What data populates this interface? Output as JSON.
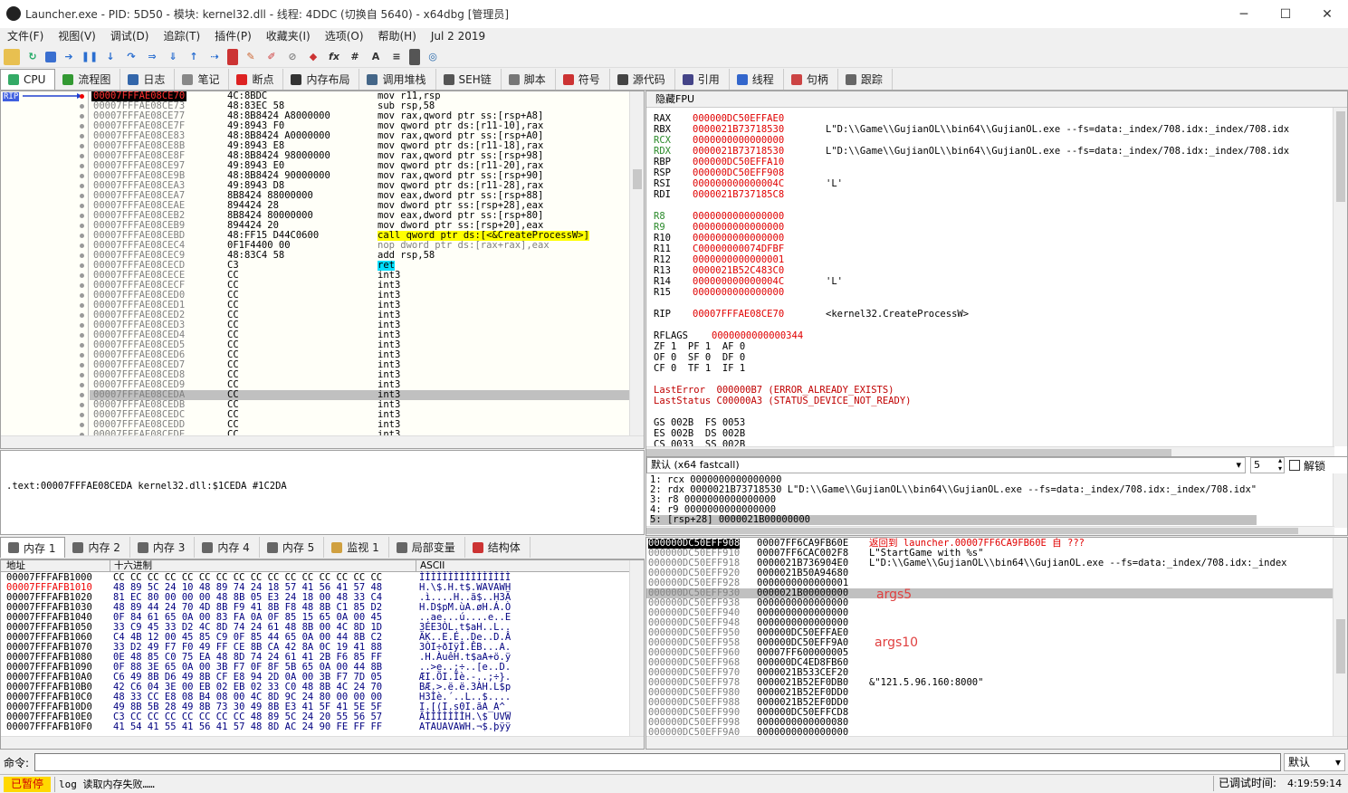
{
  "window": {
    "title": "Launcher.exe - PID: 5D50 - 模块: kernel32.dll - 线程: 4DDC (切换自 5640) - x64dbg [管理员]"
  },
  "menu": [
    "文件(F)",
    "视图(V)",
    "调试(D)",
    "追踪(T)",
    "插件(P)",
    "收藏夹(I)",
    "选项(O)",
    "帮助(H)",
    "Jul 2 2019"
  ],
  "tabs": [
    {
      "label": "CPU",
      "icon": "cpu-icon",
      "color": "#3a6"
    },
    {
      "label": "流程图",
      "icon": "graph-icon",
      "color": "#393"
    },
    {
      "label": "日志",
      "icon": "log-icon",
      "color": "#36a"
    },
    {
      "label": "笔记",
      "icon": "notes-icon",
      "color": "#888"
    },
    {
      "label": "断点",
      "icon": "breakpoint-icon",
      "color": "#d22"
    },
    {
      "label": "内存布局",
      "icon": "memory-map-icon",
      "color": "#333"
    },
    {
      "label": "调用堆栈",
      "icon": "callstack-icon",
      "color": "#468"
    },
    {
      "label": "SEH链",
      "icon": "seh-icon",
      "color": "#555"
    },
    {
      "label": "脚本",
      "icon": "script-icon",
      "color": "#777"
    },
    {
      "label": "符号",
      "icon": "symbols-icon",
      "color": "#c33"
    },
    {
      "label": "源代码",
      "icon": "source-icon",
      "color": "#444"
    },
    {
      "label": "引用",
      "icon": "references-icon",
      "color": "#448"
    },
    {
      "label": "线程",
      "icon": "threads-icon",
      "color": "#36c"
    },
    {
      "label": "句柄",
      "icon": "handles-icon",
      "color": "#c44"
    },
    {
      "label": "跟踪",
      "icon": "trace-icon",
      "color": "#666"
    }
  ],
  "disasm": {
    "rip_label": "RIP",
    "rows": [
      {
        "addr": "00007FFFAE08CE70",
        "bytes": "4C:8BDC",
        "instr": "mov r11,rsp",
        "current": true
      },
      {
        "addr": "00007FFFAE08CE73",
        "bytes": "48:83EC 58",
        "instr": "sub rsp,58"
      },
      {
        "addr": "00007FFFAE08CE77",
        "bytes": "48:8B8424 A8000000",
        "instr": "mov rax,qword ptr ss:[rsp+A8]"
      },
      {
        "addr": "00007FFFAE08CE7F",
        "bytes": "49:8943 F0",
        "instr": "mov qword ptr ds:[r11-10],rax"
      },
      {
        "addr": "00007FFFAE08CE83",
        "bytes": "48:8B8424 A0000000",
        "instr": "mov rax,qword ptr ss:[rsp+A0]"
      },
      {
        "addr": "00007FFFAE08CE8B",
        "bytes": "49:8943 E8",
        "instr": "mov qword ptr ds:[r11-18],rax"
      },
      {
        "addr": "00007FFFAE08CE8F",
        "bytes": "48:8B8424 98000000",
        "instr": "mov rax,qword ptr ss:[rsp+98]"
      },
      {
        "addr": "00007FFFAE08CE97",
        "bytes": "49:8943 E0",
        "instr": "mov qword ptr ds:[r11-20],rax"
      },
      {
        "addr": "00007FFFAE08CE9B",
        "bytes": "48:8B8424 90000000",
        "instr": "mov rax,qword ptr ss:[rsp+90]"
      },
      {
        "addr": "00007FFFAE08CEA3",
        "bytes": "49:8943 D8",
        "instr": "mov qword ptr ds:[r11-28],rax"
      },
      {
        "addr": "00007FFFAE08CEA7",
        "bytes": "8B8424 88000000",
        "instr": "mov eax,dword ptr ss:[rsp+88]"
      },
      {
        "addr": "00007FFFAE08CEAE",
        "bytes": "894424 28",
        "instr": "mov dword ptr ss:[rsp+28],eax"
      },
      {
        "addr": "00007FFFAE08CEB2",
        "bytes": "8B8424 80000000",
        "instr": "mov eax,dword ptr ss:[rsp+80]"
      },
      {
        "addr": "00007FFFAE08CEB9",
        "bytes": "894424 20",
        "instr": "mov dword ptr ss:[rsp+20],eax"
      },
      {
        "addr": "00007FFFAE08CEBD",
        "bytes": "48:FF15 D44C0600",
        "instr": "call qword ptr ds:[<&CreateProcessW>]",
        "call": true
      },
      {
        "addr": "00007FFFAE08CEC4",
        "bytes": "0F1F4400 00",
        "instr": "nop dword ptr ds:[rax+rax],eax",
        "nop": true
      },
      {
        "addr": "00007FFFAE08CEC9",
        "bytes": "48:83C4 58",
        "instr": "add rsp,58"
      },
      {
        "addr": "00007FFFAE08CECD",
        "bytes": "C3",
        "instr": "ret",
        "ret": true
      },
      {
        "addr": "00007FFFAE08CECE",
        "bytes": "CC",
        "instr": "int3"
      },
      {
        "addr": "00007FFFAE08CECF",
        "bytes": "CC",
        "instr": "int3"
      },
      {
        "addr": "00007FFFAE08CED0",
        "bytes": "CC",
        "instr": "int3"
      },
      {
        "addr": "00007FFFAE08CED1",
        "bytes": "CC",
        "instr": "int3"
      },
      {
        "addr": "00007FFFAE08CED2",
        "bytes": "CC",
        "instr": "int3"
      },
      {
        "addr": "00007FFFAE08CED3",
        "bytes": "CC",
        "instr": "int3"
      },
      {
        "addr": "00007FFFAE08CED4",
        "bytes": "CC",
        "instr": "int3"
      },
      {
        "addr": "00007FFFAE08CED5",
        "bytes": "CC",
        "instr": "int3"
      },
      {
        "addr": "00007FFFAE08CED6",
        "bytes": "CC",
        "instr": "int3"
      },
      {
        "addr": "00007FFFAE08CED7",
        "bytes": "CC",
        "instr": "int3"
      },
      {
        "addr": "00007FFFAE08CED8",
        "bytes": "CC",
        "instr": "int3"
      },
      {
        "addr": "00007FFFAE08CED9",
        "bytes": "CC",
        "instr": "int3"
      },
      {
        "addr": "00007FFFAE08CEDA",
        "bytes": "CC",
        "instr": "int3",
        "selected": true
      },
      {
        "addr": "00007FFFAE08CEDB",
        "bytes": "CC",
        "instr": "int3"
      },
      {
        "addr": "00007FFFAE08CEDC",
        "bytes": "CC",
        "instr": "int3"
      },
      {
        "addr": "00007FFFAE08CEDD",
        "bytes": "CC",
        "instr": "int3"
      },
      {
        "addr": "00007FFFAE08CEDE",
        "bytes": "CC",
        "instr": "int3"
      }
    ]
  },
  "info_line": ".text:00007FFFAE08CEDA kernel32.dll:$1CEDA #1C2DA",
  "registers": {
    "header": "隐藏FPU",
    "gp": [
      {
        "name": "RAX",
        "value": "000000DC50EFFAE0",
        "comment": ""
      },
      {
        "name": "RBX",
        "value": "0000021B73718530",
        "comment": "L\"D:\\\\Game\\\\GujianOL\\\\bin64\\\\GujianOL.exe --fs=data:_index/708.idx:_index/708.idx"
      },
      {
        "name": "RCX",
        "value": "0000000000000000",
        "comment": "",
        "hl": true
      },
      {
        "name": "RDX",
        "value": "0000021B73718530",
        "comment": "L\"D:\\\\Game\\\\GujianOL\\\\bin64\\\\GujianOL.exe --fs=data:_index/708.idx:_index/708.idx",
        "hl": true
      },
      {
        "name": "RBP",
        "value": "000000DC50EFFA10",
        "comment": ""
      },
      {
        "name": "RSP",
        "value": "000000DC50EFF908",
        "comment": ""
      },
      {
        "name": "RSI",
        "value": "000000000000004C",
        "comment": "'L'"
      },
      {
        "name": "RDI",
        "value": "0000021B737185C8",
        "comment": ""
      }
    ],
    "ext": [
      {
        "name": "R8",
        "value": "0000000000000000",
        "comment": "",
        "hl": true
      },
      {
        "name": "R9",
        "value": "0000000000000000",
        "comment": "",
        "hl": true
      },
      {
        "name": "R10",
        "value": "0000000000000000",
        "comment": ""
      },
      {
        "name": "R11",
        "value": "C00000000074DFBF",
        "comment": ""
      },
      {
        "name": "R12",
        "value": "0000000000000001",
        "comment": ""
      },
      {
        "name": "R13",
        "value": "0000021B52C483C0",
        "comment": ""
      },
      {
        "name": "R14",
        "value": "000000000000004C",
        "comment": "'L'"
      },
      {
        "name": "R15",
        "value": "0000000000000000",
        "comment": ""
      }
    ],
    "rip": {
      "name": "RIP",
      "value": "00007FFFAE08CE70",
      "comment": "<kernel32.CreateProcessW>"
    },
    "rflags": {
      "name": "RFLAGS",
      "value": "0000000000000344"
    },
    "flags": [
      "ZF 1  PF 1  AF 0",
      "OF 0  SF 0  DF 0",
      "CF 0  TF 1  IF 1"
    ],
    "lasterror": "LastError  000000B7 (ERROR_ALREADY_EXISTS)",
    "laststatus": "LastStatus C00000A3 (STATUS_DEVICE_NOT_READY)",
    "segs": [
      "GS 002B  FS 0053",
      "ES 002B  DS 002B",
      "CS 0033  SS 002B"
    ]
  },
  "callconv": {
    "select": "默认 (x64 fastcall)",
    "count": "5",
    "unlock_label": "解锁",
    "args": [
      "1: rcx 0000000000000000",
      "2: rdx 0000021B73718530 L\"D:\\\\Game\\\\GujianOL\\\\bin64\\\\GujianOL.exe --fs=data:_index/708.idx:_index/708.idx\"",
      "3: r8 0000000000000000",
      "4: r9 0000000000000000",
      "5: [rsp+28] 0000021B00000000"
    ]
  },
  "memtabs": [
    {
      "label": "内存 1",
      "active": true
    },
    {
      "label": "内存 2"
    },
    {
      "label": "内存 3"
    },
    {
      "label": "内存 4"
    },
    {
      "label": "内存 5"
    },
    {
      "label": "监视 1"
    },
    {
      "label": "局部变量"
    },
    {
      "label": "结构体"
    }
  ],
  "dump": {
    "headers": [
      "地址",
      "十六进制",
      "ASCII"
    ],
    "rows": [
      [
        "00007FFFAFB1000",
        "CC CC CC CC CC CC CC CC CC CC CC CC CC CC CC CC",
        "ÌÌÌÌÌÌÌÌÌÌÌÌÌÌÌÌ"
      ],
      [
        "00007FFFAFB1010",
        "48 89 5C 24 10 48 89 74 24 18 57 41 56 41 57 48",
        "H.\\$.H.t$.WAVAWH"
      ],
      [
        "00007FFFAFB1020",
        "81 EC 80 00 00 00 48 8B 05 E3 24 18 00 48 33 C4",
        ".ì....H..ã$..H3Ä"
      ],
      [
        "00007FFFAFB1030",
        "48 89 44 24 70 4D 8B F9 41 8B F8 48 8B C1 85 D2",
        "H.D$pM.ùA.øH.Á.Ò"
      ],
      [
        "00007FFFAFB1040",
        "0F 84 61 65 0A 00 83 FA 0A 0F 85 15 65 0A 00 45",
        "..ae...ú....e..E"
      ],
      [
        "00007FFFAFB1050",
        "33 C9 45 33 D2 4C 8D 74 24 61 48 8B 00 4C 8D 1D",
        "3ÉE3ÒL.t$aH..L.."
      ],
      [
        "00007FFFAFB1060",
        "C4 4B 12 00 45 85 C9 0F 85 44 65 0A 00 44 8B C2",
        "ÄK..E.É..De..D.Â"
      ],
      [
        "00007FFFAFB1070",
        "33 D2 49 F7 F0 49 FF CE 8B CA 42 8A 0C 19 41 88",
        "3ÒI÷ðIÿÎ.ÊB...A."
      ],
      [
        "00007FFFAFB1080",
        "0E 48 85 C0 75 EA 48 8D 74 24 61 41 2B F6 85 FF",
        ".H.ÀuêH.t$aA+ö.ÿ"
      ],
      [
        "00007FFFAFB1090",
        "0F 88 3E 65 0A 00 3B F7 0F 8F 5B 65 0A 00 44 8B",
        "..>e..;÷..[e..D."
      ],
      [
        "00007FFFAFB10A0",
        "C6 49 8B D6 49 8B CF E8 94 2D 0A 00 3B F7 7D 05",
        "ÆI.ÖI.Ïè.-..;÷}."
      ],
      [
        "00007FFFAFB10B0",
        "42 C6 04 3E 00 EB 02 EB 02 33 C0 48 8B 4C 24 70",
        "BÆ.>.ë.ë.3ÀH.L$p"
      ],
      [
        "00007FFFAFB10C0",
        "48 33 CC E8 08 B4 08 00 4C 8D 9C 24 80 00 00 00",
        "H3Ìè.´..L..$...."
      ],
      [
        "00007FFFAFB10D0",
        "49 8B 5B 28 49 8B 73 30 49 8B E3 41 5F 41 5E 5F",
        "I.[(I.s0I.ãA_A^_"
      ],
      [
        "00007FFFAFB10E0",
        "C3 CC CC CC CC CC CC CC 48 89 5C 24 20 55 56 57",
        "ÃÌÌÌÌÌÌÌH.\\$ UVW"
      ],
      [
        "00007FFFAFB10F0",
        "41 54 41 55 41 56 41 57 48 8D AC 24 90 FE FF FF",
        "ATAUAVAWH.¬$.þÿÿ"
      ]
    ]
  },
  "stack": {
    "rows": [
      {
        "addr": "000000DC50EFF908",
        "val": "00007FF6CA9FB60E",
        "comment": "返回到 launcher.00007FF6CA9FB60E 自 ???",
        "current": true
      },
      {
        "addr": "000000DC50EFF910",
        "val": "00007FF6CAC002F8",
        "comment": "L\"StartGame with %s\""
      },
      {
        "addr": "000000DC50EFF918",
        "val": "0000021B736904E0",
        "comment": "L\"D:\\\\Game\\\\GujianOL\\\\bin64\\\\GujianOL.exe --fs=data:_index/708.idx:_index"
      },
      {
        "addr": "000000DC50EFF920",
        "val": "0000021B50A94680",
        "comment": ""
      },
      {
        "addr": "000000DC50EFF928",
        "val": "0000000000000001",
        "comment": ""
      },
      {
        "addr": "000000DC50EFF930",
        "val": "0000021B00000000",
        "comment": "",
        "selected": true
      },
      {
        "addr": "000000DC50EFF938",
        "val": "0000000000000000",
        "comment": ""
      },
      {
        "addr": "000000DC50EFF940",
        "val": "0000000000000000",
        "comment": ""
      },
      {
        "addr": "000000DC50EFF948",
        "val": "0000000000000000",
        "comment": ""
      },
      {
        "addr": "000000DC50EFF950",
        "val": "000000DC50EFFAE0",
        "comment": ""
      },
      {
        "addr": "000000DC50EFF958",
        "val": "000000DC50EFF9A0",
        "comment": ""
      },
      {
        "addr": "000000DC50EFF960",
        "val": "00007FF600000005",
        "comment": ""
      },
      {
        "addr": "000000DC50EFF968",
        "val": "000000DC4ED8FB60",
        "comment": ""
      },
      {
        "addr": "000000DC50EFF970",
        "val": "0000021B533CEF20",
        "comment": ""
      },
      {
        "addr": "000000DC50EFF978",
        "val": "0000021B52EF0DB0",
        "comment": "&\"121.5.96.160:8000\""
      },
      {
        "addr": "000000DC50EFF980",
        "val": "0000021B52EF0DD0",
        "comment": ""
      },
      {
        "addr": "000000DC50EFF988",
        "val": "0000021B52EF0DD0",
        "comment": ""
      },
      {
        "addr": "000000DC50EFF990",
        "val": "000000DC50EFFCD8",
        "comment": ""
      },
      {
        "addr": "000000DC50EFF998",
        "val": "0000000000000080",
        "comment": ""
      },
      {
        "addr": "000000DC50EFF9A0",
        "val": "0000000000000000",
        "comment": ""
      }
    ],
    "annotations": [
      "args5",
      "args10"
    ]
  },
  "command": {
    "label": "命令:",
    "value": "",
    "mode": "默认"
  },
  "status": {
    "state": "已暂停",
    "message": "log 读取内存失败……",
    "timer_label": "已调试时间:",
    "timer": "4:19:59:14"
  }
}
